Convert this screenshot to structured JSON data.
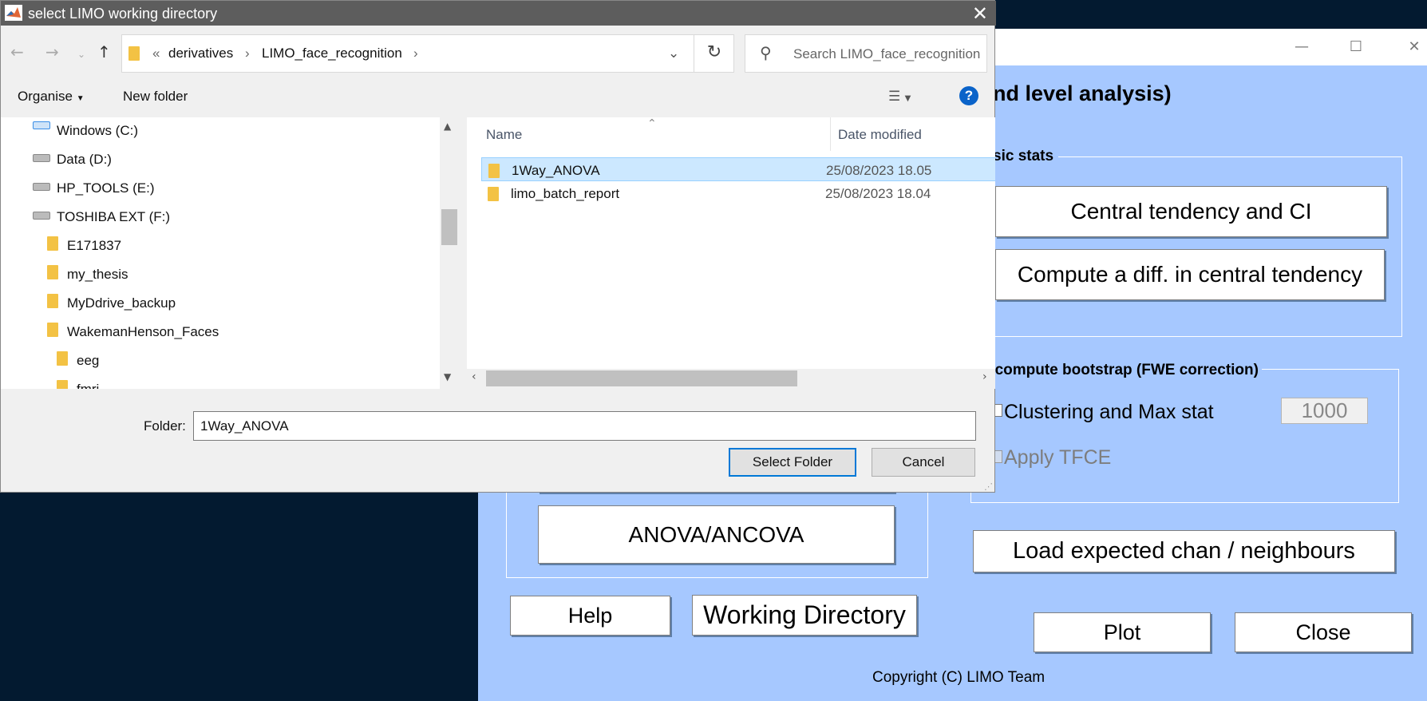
{
  "limo": {
    "title_partial": "nd level analysis)",
    "basic_stats": {
      "title": "sic stats",
      "central_tendency": "Central tendency and CI",
      "compute_diff": "Compute a diff. in central tendency"
    },
    "bootstrap": {
      "title": "ecompute bootstrap (FWE correction)",
      "clustering_label": "Clustering and Max stat",
      "n_boot": "1000",
      "tfce_label": "Apply TFCE"
    },
    "anova_button": "ANOVA/ANCOVA",
    "load_button": "Load expected chan / neighbours",
    "help_button": "Help",
    "wd_button": "Working Directory",
    "plot_button": "Plot",
    "close_button": "Close",
    "copyright": "Copyright (C) LIMO Team"
  },
  "dialog": {
    "title": "select LIMO working directory",
    "breadcrumb": [
      "«",
      "derivatives",
      "LIMO_face_recognition"
    ],
    "search_placeholder": "Search LIMO_face_recognition",
    "toolbar": {
      "organise": "Organise",
      "new_folder": "New folder",
      "help": "?"
    },
    "tree": [
      {
        "label": "Windows (C:)",
        "icon": "windows-drive-icon"
      },
      {
        "label": "Data (D:)",
        "icon": "drive-icon"
      },
      {
        "label": "HP_TOOLS (E:)",
        "icon": "drive-icon"
      },
      {
        "label": "TOSHIBA EXT (F:)",
        "icon": "drive-icon"
      },
      {
        "label": "E171837",
        "icon": "folder-icon"
      },
      {
        "label": "my_thesis",
        "icon": "folder-icon"
      },
      {
        "label": "MyDdrive_backup",
        "icon": "folder-icon"
      },
      {
        "label": "WakemanHenson_Faces",
        "icon": "folder-icon"
      },
      {
        "label": "eeg",
        "icon": "folder-icon"
      },
      {
        "label": "fmri",
        "icon": "folder-icon"
      }
    ],
    "columns": {
      "name": "Name",
      "date": "Date modified"
    },
    "files": [
      {
        "name": "1Way_ANOVA",
        "date": "25/08/2023 18.05",
        "selected": true
      },
      {
        "name": "limo_batch_report",
        "date": "25/08/2023 18.04",
        "selected": false
      }
    ],
    "folder_label": "Folder:",
    "folder_value": "1Way_ANOVA",
    "select_button": "Select Folder",
    "cancel_button": "Cancel"
  }
}
